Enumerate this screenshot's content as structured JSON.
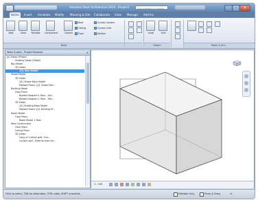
{
  "app": {
    "title": "Autodesk Revit Architecture 2010 - Project1",
    "search_placeholder": "Type a keyword or phrase"
  },
  "tabs": [
    {
      "label": "Home",
      "active": true
    },
    {
      "label": "Insert",
      "active": false
    },
    {
      "label": "Annotate",
      "active": false
    },
    {
      "label": "Modify",
      "active": false
    },
    {
      "label": "Massing & Site",
      "active": false
    },
    {
      "label": "Collaborate",
      "active": false
    },
    {
      "label": "View",
      "active": false
    },
    {
      "label": "Manage",
      "active": false
    },
    {
      "label": "Add-Ins",
      "active": false
    }
  ],
  "ribbon": {
    "build_tools": [
      "Wall",
      "Door",
      "Window",
      "Component",
      "Column"
    ],
    "small_tools": {
      "roof": "Roof",
      "ceiling": "Ceiling",
      "floor": "Floor",
      "curtain_system": "Curtain System",
      "curtain_grid": "Curtain Grid",
      "mullion": "Mullion"
    },
    "panels": {
      "build": "Build",
      "datum": "Datum",
      "room_area": "Room & Are..."
    },
    "datum_tools": [
      "Level",
      "Grid"
    ]
  },
  "browser": {
    "title": "Mass Cutout - Project Browser",
    "close": "×",
    "tree": [
      {
        "label": "[o] Views (Phase)",
        "indent": 0,
        "state": "normal"
      },
      {
        "label": "Drafting Views (Detail)",
        "indent": 2,
        "state": "normal"
      },
      {
        "label": "Box Model",
        "indent": 1,
        "state": "normal"
      },
      {
        "label": "3D Views",
        "indent": 2,
        "state": "normal"
      },
      {
        "label": "{0} Box Model",
        "indent": 3,
        "state": "selected"
      },
      {
        "label": "Shape Model",
        "indent": 1,
        "state": "normal"
      },
      {
        "label": "3D Views",
        "indent": 2,
        "state": "normal"
      },
      {
        "label": "{0} Shape Mass Model",
        "indent": 3,
        "state": "normal"
      },
      {
        "label": "Massed Floors {0} Shape Mas...",
        "indent": 3,
        "state": "normal"
      },
      {
        "label": "Building Model",
        "indent": 1,
        "state": "normal"
      },
      {
        "label": "Floor Plans",
        "indent": 2,
        "state": "normal"
      },
      {
        "label": "Bubble Diagram 1 floor - Are...",
        "indent": 3,
        "state": "normal"
      },
      {
        "label": "Bubble Diagram 1 floor - Ren...",
        "indent": 3,
        "state": "normal"
      },
      {
        "label": "3D Views",
        "indent": 2,
        "state": "normal"
      },
      {
        "label": "{0} Building Mass Model",
        "indent": 3,
        "state": "normal"
      },
      {
        "label": "Massed Floors {0} Building M...",
        "indent": 3,
        "state": "normal"
      },
      {
        "label": "Room Model",
        "indent": 1,
        "state": "normal"
      },
      {
        "label": "Floor Plans",
        "indent": 2,
        "state": "normal"
      },
      {
        "label": "Room Model 1 floor",
        "indent": 3,
        "state": "normal"
      },
      {
        "label": "New Construction",
        "indent": 1,
        "state": "normal"
      },
      {
        "label": "Floor Plans",
        "indent": 2,
        "state": "normal"
      },
      {
        "label": "Ceiling Plans",
        "indent": 2,
        "state": "normal"
      },
      {
        "label": "3D Views",
        "indent": 2,
        "state": "normal"
      },
      {
        "label": "Copy of Curtain wall, 2nd...",
        "indent": 3,
        "state": "normal"
      },
      {
        "label": "Curtain wall - Exterior ever lev...",
        "indent": 3,
        "state": "normal"
      }
    ]
  },
  "viewport": {
    "scale": "1 : 100"
  },
  "status": {
    "hint": "Click to select, TAB for alternates, CTRL adds, SHIFT unselects.",
    "editable_only": "Editable Only",
    "press_drag": "Press & Drag",
    "filter_count": ":0"
  }
}
